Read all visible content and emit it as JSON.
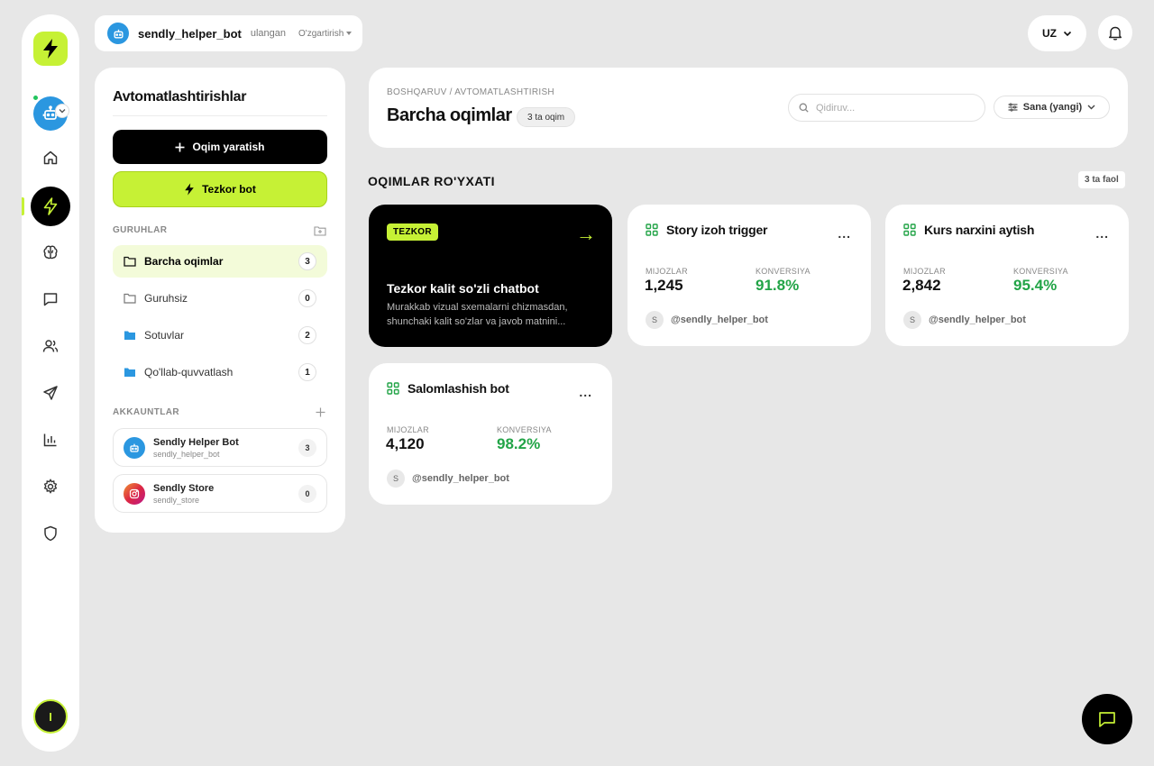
{
  "colors": {
    "accent": "#c6f135",
    "dark": "#000000",
    "positive": "#22a447",
    "telegram": "#2b97e0",
    "background": "#e7e7e7"
  },
  "rail": {
    "logo_icon": "bolt-icon",
    "bot_icon": "robot-icon",
    "nav_icons": [
      "home-icon",
      "bolt-icon",
      "brain-icon",
      "message-icon",
      "users-icon",
      "send-icon",
      "chart-icon",
      "gear-icon",
      "shield-icon"
    ],
    "active_nav": "bolt-icon",
    "user_initial": "I"
  },
  "topbar": {
    "bot_name": "sendly_helper_bot",
    "bot_status": "ulangan",
    "change_label": "O'zgartirish",
    "lang": "UZ"
  },
  "sidebar": {
    "title": "Avtomatlashtirishlar",
    "create_label": "Oqim yaratish",
    "quick_label": "Tezkor bot",
    "groups_label": "GURUHLAR",
    "groups": [
      {
        "label": "Barcha oqimlar",
        "count": "3",
        "active": true,
        "icon": "folder-outline-icon"
      },
      {
        "label": "Guruhsiz",
        "count": "0",
        "active": false,
        "icon": "folder-outline-icon"
      },
      {
        "label": "Sotuvlar",
        "count": "2",
        "active": false,
        "icon": "folder-filled-icon"
      },
      {
        "label": "Qo'llab-quvvatlash",
        "count": "1",
        "active": false,
        "icon": "folder-filled-icon"
      }
    ],
    "accounts_label": "AKKAUNTLAR",
    "accounts": [
      {
        "name": "Sendly Helper Bot",
        "handle": "sendly_helper_bot",
        "count": "3",
        "icon": "telegram-icon"
      },
      {
        "name": "Sendly Store",
        "handle": "sendly_store",
        "count": "0",
        "icon": "instagram-icon"
      }
    ]
  },
  "header": {
    "breadcrumb": "BOSHQARUV / AVTOMATLASHTIRISH",
    "title": "Barcha oqimlar",
    "badge": "3 ta oqim",
    "search_placeholder": "Qidiruv...",
    "sort_label": "Sana (yangi)"
  },
  "list": {
    "title": "OQIMLAR RO'YXATI",
    "active_badge": "3 ta faol",
    "featured": {
      "tag": "TEZKOR",
      "arrow": "→",
      "title": "Tezkor kalit so'zli chatbot",
      "description": "Murakkab vizual sxemalarni chizmasdan, shunchaki kalit so'zlar va javob matnini..."
    },
    "cards": [
      {
        "title": "Story izoh trigger",
        "more": "...",
        "clients_label": "MIJOZLAR",
        "clients": "1,245",
        "conv_label": "KONVERSIYA",
        "conv": "91.8%",
        "avatar": "S",
        "handle": "@sendly_helper_bot"
      },
      {
        "title": "Kurs narxini aytish",
        "more": "...",
        "clients_label": "MIJOZLAR",
        "clients": "2,842",
        "conv_label": "KONVERSIYA",
        "conv": "95.4%",
        "avatar": "S",
        "handle": "@sendly_helper_bot"
      },
      {
        "title": "Salomlashish bot",
        "more": "...",
        "clients_label": "MIJOZLAR",
        "clients": "4,120",
        "conv_label": "KONVERSIYA",
        "conv": "98.2%",
        "avatar": "S",
        "handle": "@sendly_helper_bot"
      }
    ]
  },
  "fab_icon": "chat-icon"
}
